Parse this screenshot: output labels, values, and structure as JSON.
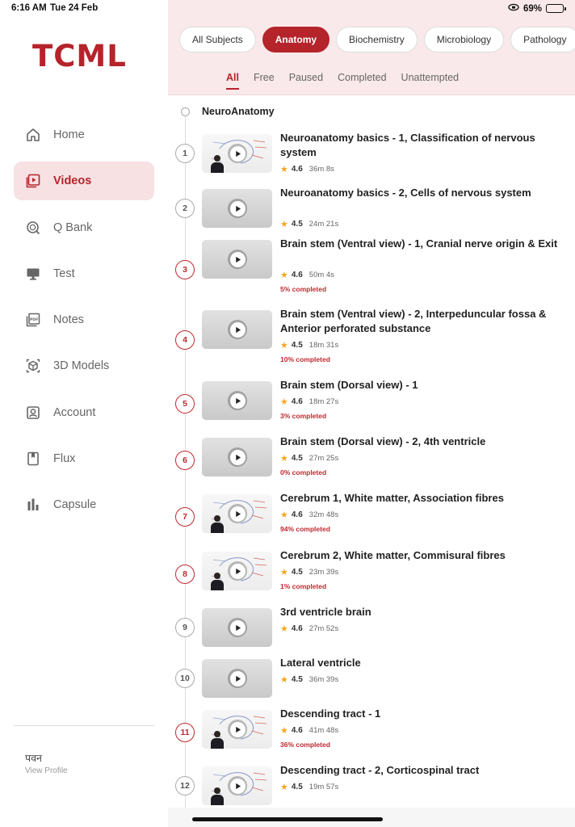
{
  "status": {
    "time": "6:16 AM",
    "date": "Tue 24 Feb",
    "battery": "69%",
    "battery_level": 0.69
  },
  "brand": {
    "logo": "TCML",
    "accent_color": "#b5242b"
  },
  "sidebar": {
    "items": [
      {
        "label": "Home",
        "icon": "home-icon"
      },
      {
        "label": "Videos",
        "icon": "video-icon",
        "active": true
      },
      {
        "label": "Q Bank",
        "icon": "qbank-icon"
      },
      {
        "label": "Test",
        "icon": "monitor-icon"
      },
      {
        "label": "Notes",
        "icon": "pdf-icon"
      },
      {
        "label": "3D Models",
        "icon": "cube-icon"
      },
      {
        "label": "Account",
        "icon": "account-icon"
      },
      {
        "label": "Flux",
        "icon": "bookmark-icon"
      },
      {
        "label": "Capsule",
        "icon": "bar-chart-icon"
      }
    ],
    "profile_name": "पवन",
    "profile_link": "View Profile"
  },
  "subjects": [
    "All Subjects",
    "Anatomy",
    "Biochemistry",
    "Microbiology",
    "Pathology"
  ],
  "active_subject": "Anatomy",
  "filters": [
    "All",
    "Free",
    "Paused",
    "Completed",
    "Unattempted"
  ],
  "active_filter": "All",
  "section_title": "NeuroAnatomy",
  "videos": [
    {
      "n": "1",
      "title": "Neuroanatomy basics - 1, Classification of nervous system",
      "rating": "4.6",
      "duration": "36m 8s",
      "progress": "",
      "thumb": "board"
    },
    {
      "n": "2",
      "title": "Neuroanatomy basics - 2, Cells of nervous system",
      "rating": "4.5",
      "duration": "24m 21s",
      "progress": "",
      "thumb": "plain"
    },
    {
      "n": "3",
      "title": "Brain stem (Ventral view) - 1, Cranial nerve origin & Exit",
      "rating": "4.6",
      "duration": "50m 4s",
      "progress": "5% completed",
      "thumb": "plain"
    },
    {
      "n": "4",
      "title": "Brain stem (Ventral view) - 2, Interpeduncular fossa & Anterior perforated substance",
      "rating": "4.5",
      "duration": "18m 31s",
      "progress": "10% completed",
      "thumb": "plain"
    },
    {
      "n": "5",
      "title": "Brain stem (Dorsal view) - 1",
      "rating": "4.6",
      "duration": "18m 27s",
      "progress": "3% completed",
      "thumb": "plain"
    },
    {
      "n": "6",
      "title": "Brain stem (Dorsal view) - 2, 4th ventricle",
      "rating": "4.5",
      "duration": "27m 25s",
      "progress": "0% completed",
      "thumb": "plain"
    },
    {
      "n": "7",
      "title": "Cerebrum 1, White matter, Association fibres",
      "rating": "4.6",
      "duration": "32m 48s",
      "progress": "94% completed",
      "thumb": "board"
    },
    {
      "n": "8",
      "title": "Cerebrum 2, White matter, Commisural fibres",
      "rating": "4.5",
      "duration": "23m 39s",
      "progress": "1% completed",
      "thumb": "board"
    },
    {
      "n": "9",
      "title": "3rd ventricle brain",
      "rating": "4.6",
      "duration": "27m 52s",
      "progress": "",
      "thumb": "plain"
    },
    {
      "n": "10",
      "title": "Lateral ventricle",
      "rating": "4.5",
      "duration": "36m 39s",
      "progress": "",
      "thumb": "plain"
    },
    {
      "n": "11",
      "title": "Descending tract - 1",
      "rating": "4.6",
      "duration": "41m 48s",
      "progress": "36% completed",
      "thumb": "board"
    },
    {
      "n": "12",
      "title": "Descending tract - 2, Corticospinal tract",
      "rating": "4.5",
      "duration": "19m 57s",
      "progress": "",
      "thumb": "board"
    }
  ]
}
